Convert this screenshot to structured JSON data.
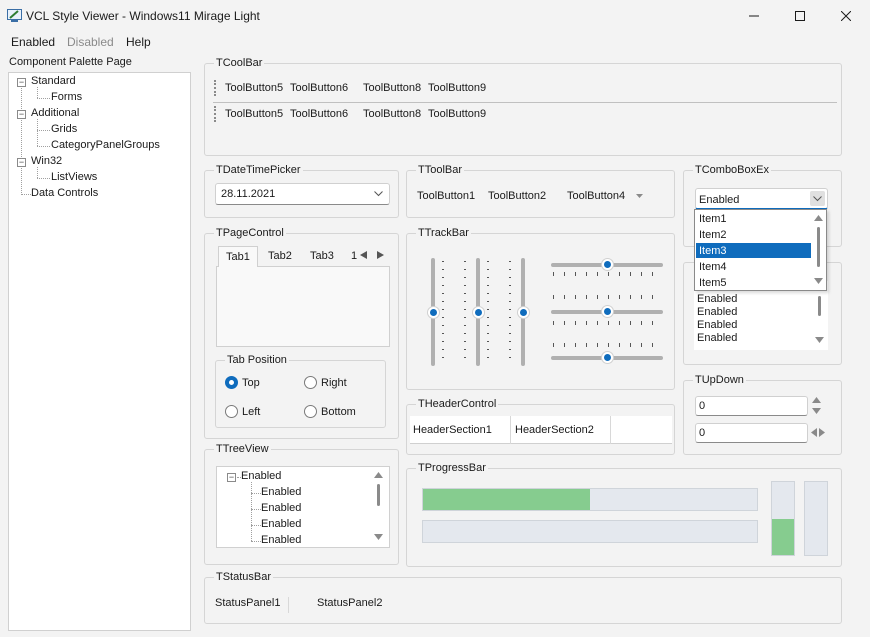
{
  "window": {
    "title": "VCL Style Viewer - Windows11 Mirage Light"
  },
  "menu": {
    "enabled": "Enabled",
    "disabled": "Disabled",
    "help": "Help"
  },
  "palette": {
    "label": "Component Palette Page",
    "items": [
      "Standard",
      "Forms",
      "Additional",
      "Grids",
      "CategoryPanelGroups",
      "Win32",
      "ListViews",
      "Data Controls"
    ]
  },
  "coolbar": {
    "title": "TCoolBar",
    "row1": [
      "ToolButton5",
      "ToolButton6",
      "ToolButton8",
      "ToolButton9"
    ],
    "row2": [
      "ToolButton5",
      "ToolButton6",
      "ToolButton8",
      "ToolButton9"
    ]
  },
  "datetime": {
    "title": "TDateTimePicker",
    "value": "28.11.2021"
  },
  "toolbar": {
    "title": "TToolBar",
    "buttons": [
      "ToolButton1",
      "ToolButton2",
      "ToolButton4"
    ]
  },
  "comboex": {
    "title": "TComboBoxEx",
    "value": "Enabled",
    "items": [
      "Item1",
      "Item2",
      "Item3",
      "Item4",
      "Item5"
    ],
    "selected": "Item3"
  },
  "listbox": {
    "items": [
      "Enabled",
      "Enabled",
      "Enabled",
      "Enabled"
    ]
  },
  "pagecontrol": {
    "title": "TPageControl",
    "tabs": [
      "Tab1",
      "Tab2",
      "Tab3",
      "1"
    ],
    "position_title": "Tab Position",
    "radios": [
      "Top",
      "Right",
      "Left",
      "Bottom"
    ]
  },
  "trackbar": {
    "title": "TTrackBar"
  },
  "updown": {
    "title": "TUpDown",
    "value1": "0",
    "value2": "0"
  },
  "header": {
    "title": "THeaderControl",
    "sections": [
      "HeaderSection1",
      "HeaderSection2"
    ]
  },
  "treeview": {
    "title": "TTreeView",
    "root": "Enabled",
    "children": [
      "Enabled",
      "Enabled",
      "Enabled",
      "Enabled"
    ]
  },
  "progress": {
    "title": "TProgressBar",
    "h1": 0.5,
    "h2": 0,
    "v1": 0.5,
    "v2": 0,
    "color": "#86cc8f"
  },
  "statusbar": {
    "title": "TStatusBar",
    "panels": [
      "StatusPanel1",
      "StatusPanel2"
    ]
  },
  "colors": {
    "accent": "#0f6cbd",
    "selection": "#0f6cbd"
  }
}
